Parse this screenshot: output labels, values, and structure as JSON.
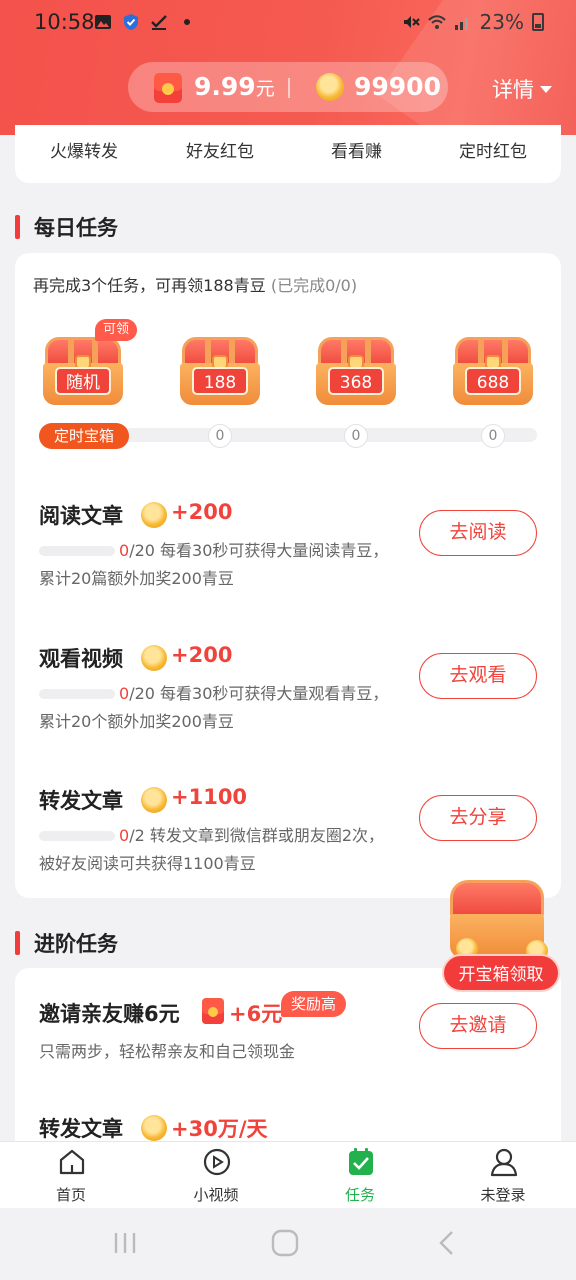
{
  "status_bar": {
    "time": "10:58",
    "battery": "23%"
  },
  "header": {
    "cash_value": "9.99",
    "cash_unit": "元",
    "coin_value": "99900",
    "detail_label": "详情"
  },
  "shortcuts": [
    "火爆转发",
    "好友红包",
    "看看赚",
    "定时红包"
  ],
  "daily": {
    "title": "每日任务",
    "hint": "再完成3个任务，可再领188青豆",
    "hint_progress": "(已完成0/0)",
    "chests": [
      {
        "label": "随机",
        "badge": "可领"
      },
      {
        "label": "188"
      },
      {
        "label": "368"
      },
      {
        "label": "688"
      }
    ],
    "timed_chest_label": "定时宝箱",
    "milestones": [
      "0",
      "0",
      "0"
    ],
    "tasks": [
      {
        "title": "阅读文章",
        "reward": "+200",
        "done": "0",
        "total": "/20",
        "desc": "每看30秒可获得大量阅读青豆，累计20篇额外加奖200青豆",
        "button": "去阅读",
        "progress": 0
      },
      {
        "title": "观看视频",
        "reward": "+200",
        "done": "0",
        "total": "/20",
        "desc": "每看30秒可获得大量观看青豆，累计20个额外加奖200青豆",
        "button": "去观看",
        "progress": 0
      },
      {
        "title": "转发文章",
        "reward": "+1100",
        "done": "0",
        "total": "/2",
        "desc": "转发文章到微信群或朋友圈2次，被好友阅读可共获得1100青豆",
        "button": "去分享",
        "progress": 0
      }
    ]
  },
  "advanced": {
    "title": "进阶任务",
    "tasks": [
      {
        "title": "邀请亲友赚6元",
        "reward": "+6元",
        "badge": "奖励高",
        "desc": "只需两步，轻松帮亲友和自己领现金",
        "button": "去邀请"
      },
      {
        "title": "转发文章",
        "reward": "+30万/天"
      }
    ]
  },
  "floating": {
    "label": "开宝箱领取"
  },
  "bottom_nav": [
    {
      "label": "首页",
      "icon": "home-icon"
    },
    {
      "label": "小视频",
      "icon": "play-icon"
    },
    {
      "label": "任务",
      "icon": "task-icon",
      "active": true
    },
    {
      "label": "未登录",
      "icon": "user-icon"
    }
  ],
  "colors": {
    "brand_red": "#f23c3c",
    "nav_active": "#22b14c",
    "timed_orange": "#f0561d"
  }
}
